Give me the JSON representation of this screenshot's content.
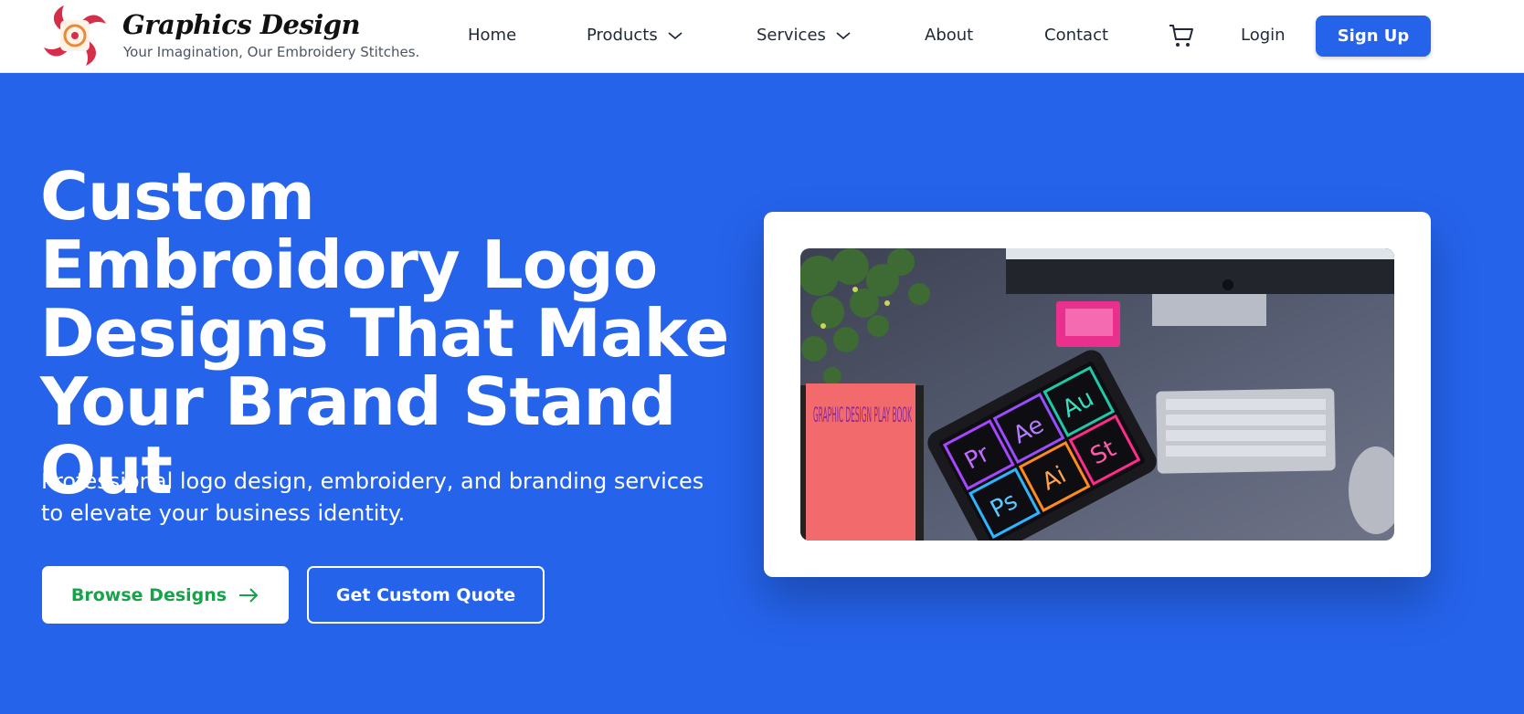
{
  "brand": {
    "name": "Graphics Design",
    "tagline": "Your Imagination, Our Embroidery Stitches."
  },
  "nav": {
    "items": [
      {
        "label": "Home"
      },
      {
        "label": "Products",
        "has_dropdown": true
      },
      {
        "label": "Services",
        "has_dropdown": true
      },
      {
        "label": "About"
      },
      {
        "label": "Contact"
      }
    ],
    "cart_icon": "shopping-cart-icon",
    "login_label": "Login",
    "signup_label": "Sign Up"
  },
  "hero": {
    "title": "Custom Embroidory Logo Designs That Make Your Brand Stand Out",
    "subtitle": "Professional logo design, embroidery, and branding services to elevate your business identity.",
    "browse_label": "Browse Designs",
    "quote_label": "Get Custom Quote",
    "image": {
      "book_text": "GRAPHIC DESIGN PLAY BOOK",
      "app_tiles": [
        "Pr",
        "Ae",
        "Au",
        "Ps",
        "Ai",
        "St"
      ]
    }
  },
  "colors": {
    "primary": "#2563eb",
    "browse_text": "#16a34a",
    "logo_red": "#d62e4a"
  }
}
